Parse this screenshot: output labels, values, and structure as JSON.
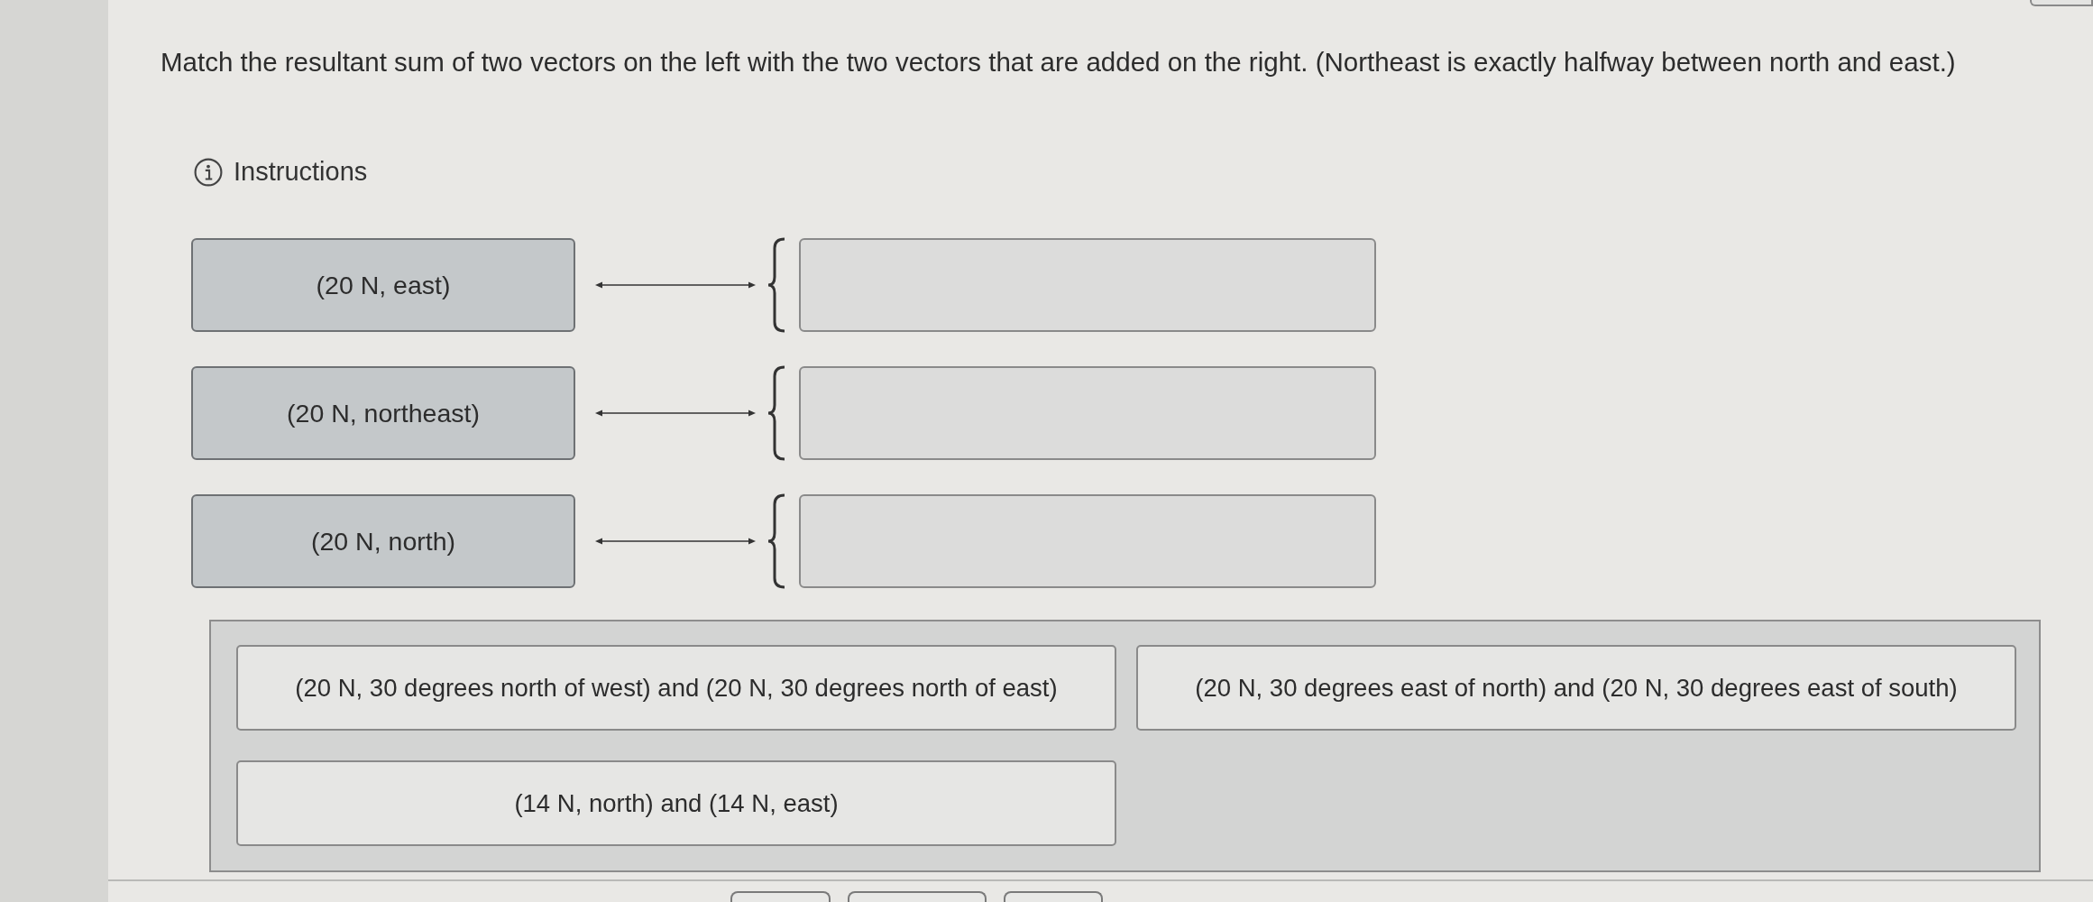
{
  "question": "Match the resultant sum of two vectors on the left with the two vectors that are added on the right. (Northeast is exactly halfway between north and east.)",
  "instructions": {
    "label": "Instructions"
  },
  "rows": [
    {
      "prompt": "(20 N, east)"
    },
    {
      "prompt": "(20 N, northeast)"
    },
    {
      "prompt": "(20 N, north)"
    }
  ],
  "choices": [
    "(20 N, 30 degrees north of west) and (20 N, 30 degrees north of east)",
    "(20 N, 30 degrees east of north) and (20 N, 30 degrees east of south)",
    "(14 N, north) and (14 N, east)"
  ]
}
